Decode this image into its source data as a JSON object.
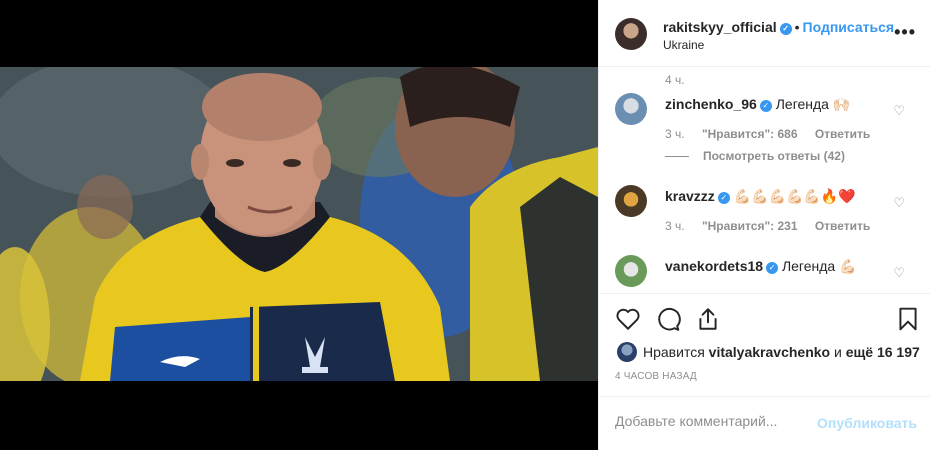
{
  "header": {
    "username": "rakitskyy_official",
    "follow_label": "Подписаться",
    "location": "Ukraine",
    "more": "•••"
  },
  "caption_time": "4 ч.",
  "comments": [
    {
      "username": "zinchenko_96",
      "verified": true,
      "text": "Легенда 🙌🏻",
      "time": "3 ч.",
      "likes": "\"Нравится\": 686",
      "reply_label": "Ответить",
      "view_replies": "Посмотреть ответы (42)"
    },
    {
      "username": "kravzzz",
      "verified": true,
      "text": "💪🏻💪🏻💪🏻💪🏻💪🏻🔥❤️",
      "time": "3 ч.",
      "likes": "\"Нравится\": 231",
      "reply_label": "Ответить"
    },
    {
      "username": "vanekordets18",
      "verified": true,
      "text": "Легенда 💪🏻"
    }
  ],
  "likes": {
    "prefix": "Нравится",
    "user": "vitalyakravchenko",
    "middle": "и",
    "others": "ещё 16 197"
  },
  "timestamp": "4 ЧАСОВ НАЗАД",
  "add_comment": {
    "placeholder": "Добавьте комментарий...",
    "publish_label": "Опубликовать"
  },
  "icons": [
    "heart-icon",
    "comment-icon",
    "share-icon",
    "bookmark-icon",
    "verified-icon",
    "more-icon"
  ],
  "colors": {
    "accent": "#3897f0",
    "muted": "#8e8e8e",
    "publish_disabled": "#b2dffc",
    "jersey_yellow": "#e8c81f",
    "jersey_blue": "#1d4fa0"
  }
}
